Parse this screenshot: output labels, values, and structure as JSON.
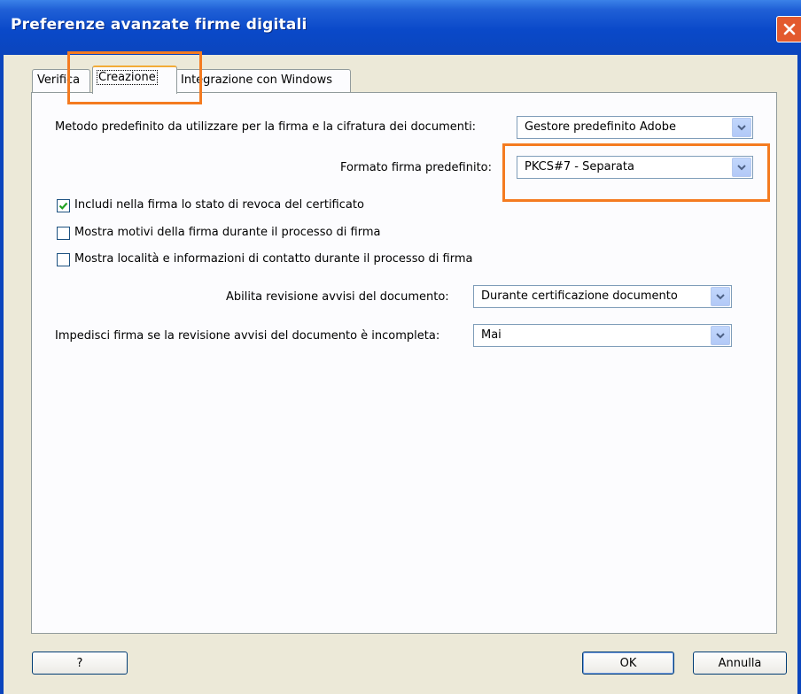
{
  "window": {
    "title": "Preferenze avanzate firme digitali"
  },
  "tabs": [
    {
      "label": "Verifica"
    },
    {
      "label": "Creazione"
    },
    {
      "label": "Integrazione con Windows"
    }
  ],
  "fields": {
    "metodo": {
      "label": "Metodo predefinito da utilizzare per la firma e la cifratura dei documenti:",
      "value": "Gestore predefinito Adobe"
    },
    "formato": {
      "label": "Formato firma predefinito:",
      "value": "PKCS#7 - Separata"
    },
    "revisione": {
      "label": "Abilita revisione avvisi del documento:",
      "value": "Durante certificazione documento"
    },
    "impedisci": {
      "label": "Impedisci firma se la revisione avvisi del documento è incompleta:",
      "value": "Mai"
    }
  },
  "checkboxes": [
    {
      "label": "Includi nella firma lo stato di revoca del certificato",
      "checked": true
    },
    {
      "label": "Mostra motivi della firma durante il processo di firma",
      "checked": false
    },
    {
      "label": "Mostra località e informazioni di contatto durante il processo di firma",
      "checked": false
    }
  ],
  "buttons": {
    "help": "?",
    "ok": "OK",
    "cancel": "Annulla"
  },
  "colors": {
    "titlebar": "#0b45bd",
    "highlight": "#f47b20",
    "check": "#21a121"
  },
  "icons": [
    "close-icon",
    "chevron-down-icon",
    "checkmark-icon"
  ]
}
